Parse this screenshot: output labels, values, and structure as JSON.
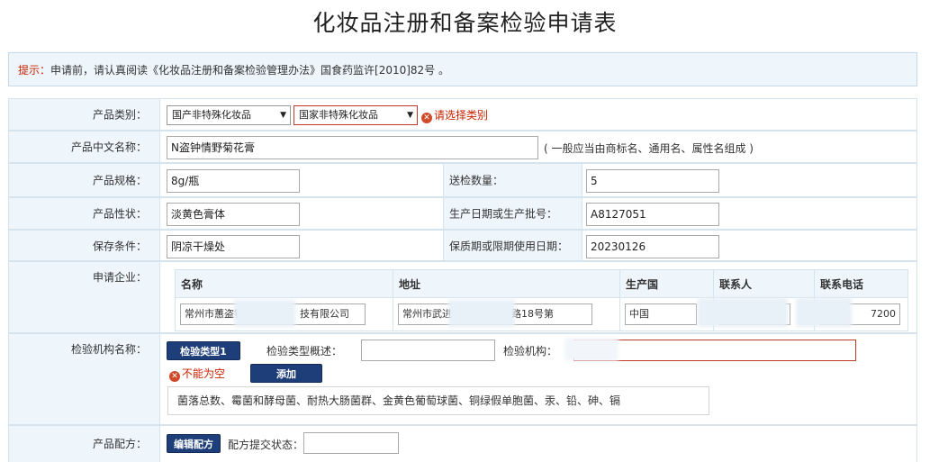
{
  "page_title": "化妆品注册和备案检验申请表",
  "tip": {
    "label": "提示：",
    "text": "申请前，请认真阅读《化妆品注册和备案检验管理办法》国食药监许[2010]82号 。"
  },
  "category": {
    "label": "产品类别：",
    "select1": "国产非特殊化妆品",
    "select2": "国家非特殊化妆品",
    "error": "请选择类别"
  },
  "cn_name": {
    "label": "产品中文名称：",
    "value": "N盗钟情野菊花膏",
    "hint": "( 一般应当由商标名、通用名、属性名组成 )"
  },
  "spec": {
    "label": "产品规格：",
    "value": "8g/瓶",
    "qty_label": "送检数量：",
    "qty_value": "5"
  },
  "nature": {
    "label": "产品性状：",
    "value": "淡黄色膏体",
    "batch_label": "生产日期或生产批号：",
    "batch_value": "A8127051"
  },
  "storage": {
    "label": "保存条件：",
    "value": "阴凉干燥处",
    "expiry_label": "保质期或限期使用日期：",
    "expiry_value": "20230126"
  },
  "enterprise": {
    "label": "申请企业：",
    "headers": [
      "名称",
      "地址",
      "生产国",
      "联系人",
      "联系电话"
    ],
    "row": {
      "name": "常州市蕙盗钟",
      "name_tail": "技有限公司",
      "address": "常州市武进",
      "address_tail": "路18号第",
      "country": "中国",
      "contact": "",
      "phone_tail": "7200"
    }
  },
  "inspection": {
    "label": "检验机构名称：",
    "type_button": "检验类型1",
    "overview_label": "检验类型概述：",
    "overview_value": "",
    "org_label": "检验机构：",
    "org_value": "",
    "error": "不能为空",
    "add_button": "添加",
    "items": "菌落总数、霉菌和酵母菌、耐热大肠菌群、金黄色葡萄球菌、铜绿假单胞菌、汞、铅、砷、镉"
  },
  "formula": {
    "label": "产品配方：",
    "edit_button": "编辑配方",
    "status_label": "配方提交状态：",
    "status_value": ""
  },
  "colors": {
    "label_bg": "#eef5fb",
    "border": "#d5e3ef",
    "button": "#1e3e7a",
    "error": "#cc2200"
  }
}
